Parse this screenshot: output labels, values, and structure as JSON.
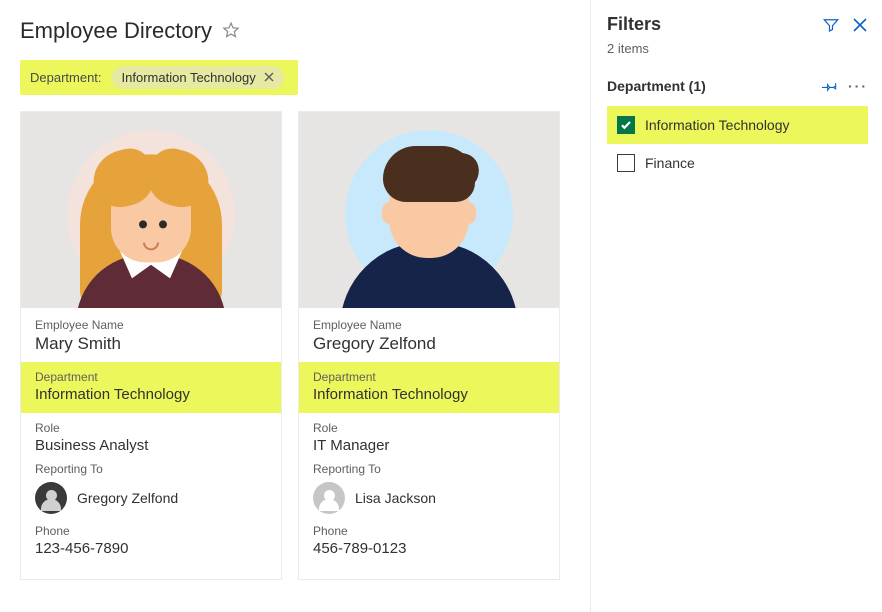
{
  "page": {
    "title": "Employee Directory"
  },
  "filter_bar": {
    "label": "Department:",
    "value": "Information Technology"
  },
  "labels": {
    "employee_name": "Employee Name",
    "department": "Department",
    "role": "Role",
    "reporting_to": "Reporting To",
    "phone": "Phone"
  },
  "cards": [
    {
      "name": "Mary Smith",
      "department": "Information Technology",
      "role": "Business Analyst",
      "reporting_to": "Gregory Zelfond",
      "phone": "123-456-7890"
    },
    {
      "name": "Gregory Zelfond",
      "department": "Information Technology",
      "role": "IT Manager",
      "reporting_to": "Lisa Jackson",
      "phone": "456-789-0123"
    }
  ],
  "sidebar": {
    "title": "Filters",
    "item_count": "2 items",
    "section_label": "Department (1)",
    "options": [
      {
        "label": "Information Technology",
        "checked": true
      },
      {
        "label": "Finance",
        "checked": false
      }
    ]
  }
}
